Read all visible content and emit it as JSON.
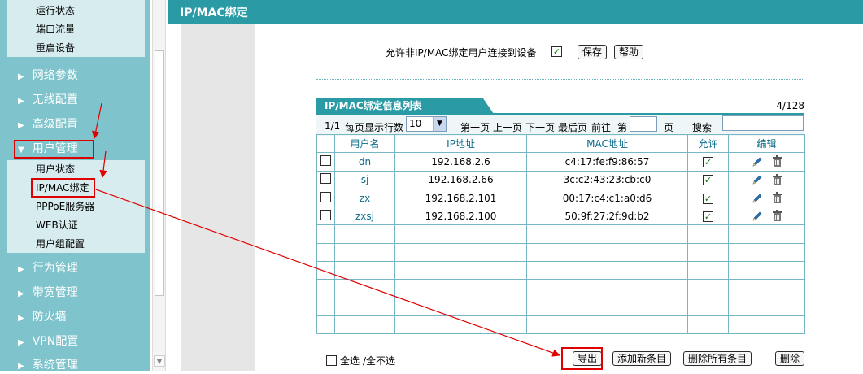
{
  "sidebar": {
    "top_subitems": [
      "运行状态",
      "端口流量",
      "重启设备"
    ],
    "menu": [
      {
        "label": "网络参数"
      },
      {
        "label": "无线配置"
      },
      {
        "label": "高级配置"
      },
      {
        "label": "用户管理"
      },
      {
        "label": "行为管理"
      },
      {
        "label": "带宽管理"
      },
      {
        "label": "防火墙"
      },
      {
        "label": "VPN配置"
      },
      {
        "label": "系统管理"
      }
    ],
    "collapsed_icon": "▶",
    "expanded_icon": "▼",
    "user_subitems": [
      "用户状态",
      "IP/MAC绑定",
      "PPPoE服务器",
      "WEB认证",
      "用户组配置"
    ]
  },
  "header": {
    "title": "IP/MAC绑定"
  },
  "settings": {
    "allow_label": "允许非IP/MAC绑定用户连接到设备",
    "allow_checked": true,
    "save_label": "保存",
    "help_label": "帮助"
  },
  "list": {
    "tab_title": "IP/MAC绑定信息列表",
    "count": "4/128",
    "pager": {
      "page_info": "1/1",
      "rows_per_page_label": "每页显示行数",
      "rows_per_page_value": "10",
      "first": "第一页",
      "prev": "上一页",
      "next": "下一页",
      "last": "最后页",
      "goto": "前往",
      "page_prefix": "第",
      "page_suffix": "页",
      "search_label": "搜索"
    },
    "columns": [
      "用户名",
      "IP地址",
      "MAC地址",
      "允许",
      "编辑"
    ],
    "rows": [
      {
        "user": "dn",
        "ip": "192.168.2.6",
        "mac": "c4:17:fe:f9:86:57",
        "allow": true
      },
      {
        "user": "sj",
        "ip": "192.168.2.66",
        "mac": "3c:c2:43:23:cb:c0",
        "allow": true
      },
      {
        "user": "zx",
        "ip": "192.168.2.101",
        "mac": "00:17:c4:c1:a0:d6",
        "allow": true
      },
      {
        "user": "zxsj",
        "ip": "192.168.2.100",
        "mac": "50:9f:27:2f:9d:b2",
        "allow": true
      }
    ],
    "empty_rows": 6
  },
  "footer": {
    "select_all": "全选",
    "select_none": "/全不选",
    "export": "导出",
    "add_entry": "添加新条目",
    "delete_all": "删除所有条目",
    "delete": "删除"
  },
  "colors": {
    "sidebar": "#7fc4cc",
    "accent": "#2a9aa5",
    "annotation": "#e00000"
  }
}
